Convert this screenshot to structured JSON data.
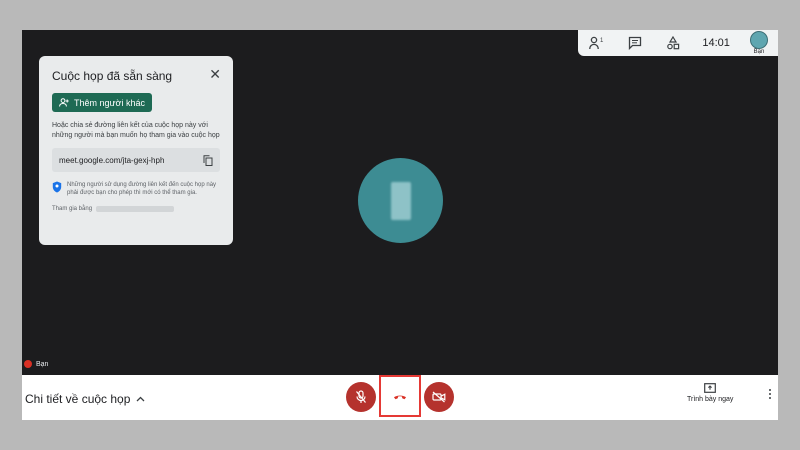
{
  "topbar": {
    "time": "14:01",
    "self_label": "Bạn",
    "people_icon": "people-icon",
    "chat_icon": "chat-icon",
    "activities_icon": "activities-icon"
  },
  "panel": {
    "title": "Cuộc họp đã sẵn sàng",
    "add_button": "Thêm người khác",
    "share_text": "Hoặc chia sẻ đường liên kết của cuộc họp này với những người mà bạn muốn họ tham gia vào cuộc họp",
    "link": "meet.google.com/jta-gexj-hph",
    "note": "Những người sử dụng đường liên kết đến cuộc họp này phải được bạn cho phép thì mới có thể tham gia.",
    "join_label": "Tham gia bằng"
  },
  "video": {
    "self_name": "Bạn"
  },
  "bottombar": {
    "details_label": "Chi tiết về cuộc họp",
    "present_label": "Trình bày ngay"
  },
  "colors": {
    "accent_green": "#1e6a54",
    "control_red": "#b5322d",
    "highlight_red": "#e53935",
    "avatar_teal": "#3d8c93"
  }
}
